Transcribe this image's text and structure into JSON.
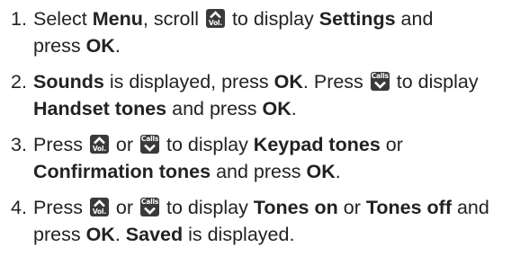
{
  "colors": {
    "text": "#222222",
    "key_bg": "#3a3a3a",
    "key_fg": "#ffffff"
  },
  "icons": {
    "scroll_up": "chevron-up-vol-key",
    "scroll_down": "chevron-down-calls-key"
  },
  "keys": {
    "vol_label": "Vol.",
    "calls_label": "Calls"
  },
  "steps": [
    {
      "number": "1.",
      "t1": "Select ",
      "menu": "Menu",
      "t2": ", scroll ",
      "t3": " to display ",
      "settings": "Settings",
      "t4": " and",
      "t5": "press ",
      "ok": "OK",
      "t6": "."
    },
    {
      "number": "2.",
      "sounds": "Sounds",
      "t1": " is displayed, press ",
      "ok1": "OK",
      "t2": ". Press ",
      "t3": " to display",
      "handset": "Handset tones",
      "t4": " and press ",
      "ok2": "OK",
      "t5": "."
    },
    {
      "number": "3.",
      "t1": "Press ",
      "t2": " or ",
      "t3": " to display ",
      "keypad": "Keypad tones",
      "t4": " or",
      "confirm": "Confirmation tones",
      "t5": " and press ",
      "ok": "OK",
      "t6": "."
    },
    {
      "number": "4.",
      "t1": "Press ",
      "t2": " or ",
      "t3": " to display ",
      "tones_on": "Tones on",
      "t4": " or ",
      "tones_off": "Tones off",
      "t5": " and",
      "t6": "press ",
      "ok": "OK",
      "t7": ". ",
      "saved": "Saved",
      "t8": " is displayed."
    }
  ]
}
